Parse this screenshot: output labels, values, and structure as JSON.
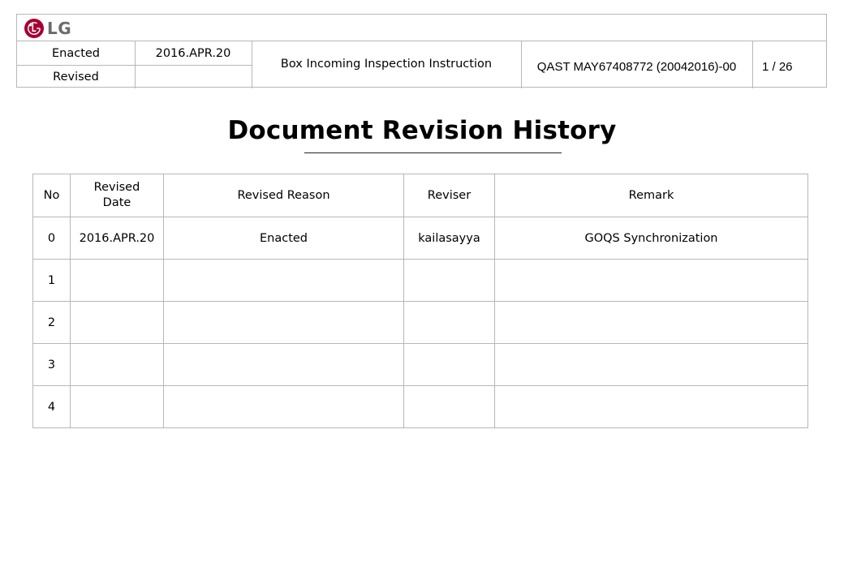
{
  "logo": {
    "text": "LG",
    "brand_color": "#a50034",
    "text_color": "#6b6b6b"
  },
  "header": {
    "enacted_label": "Enacted",
    "enacted_date": "2016.APR.20",
    "revised_label": "Revised",
    "revised_date": "",
    "doc_title": "Box Incoming Inspection Instruction",
    "doc_number": "QAST MAY67408772 (20042016)-00",
    "page": "1 / 26"
  },
  "title": "Document Revision History",
  "table": {
    "columns": [
      "No",
      "Revised Date",
      "Revised Reason",
      "Reviser",
      "Remark"
    ],
    "rows": [
      {
        "no": "0",
        "date": "2016.APR.20",
        "reason": "Enacted",
        "reviser": "kailasayya",
        "remark": "GOQS Synchronization"
      },
      {
        "no": "1",
        "date": "",
        "reason": "",
        "reviser": "",
        "remark": ""
      },
      {
        "no": "2",
        "date": "",
        "reason": "",
        "reviser": "",
        "remark": ""
      },
      {
        "no": "3",
        "date": "",
        "reason": "",
        "reviser": "",
        "remark": ""
      },
      {
        "no": "4",
        "date": "",
        "reason": "",
        "reviser": "",
        "remark": ""
      }
    ]
  }
}
